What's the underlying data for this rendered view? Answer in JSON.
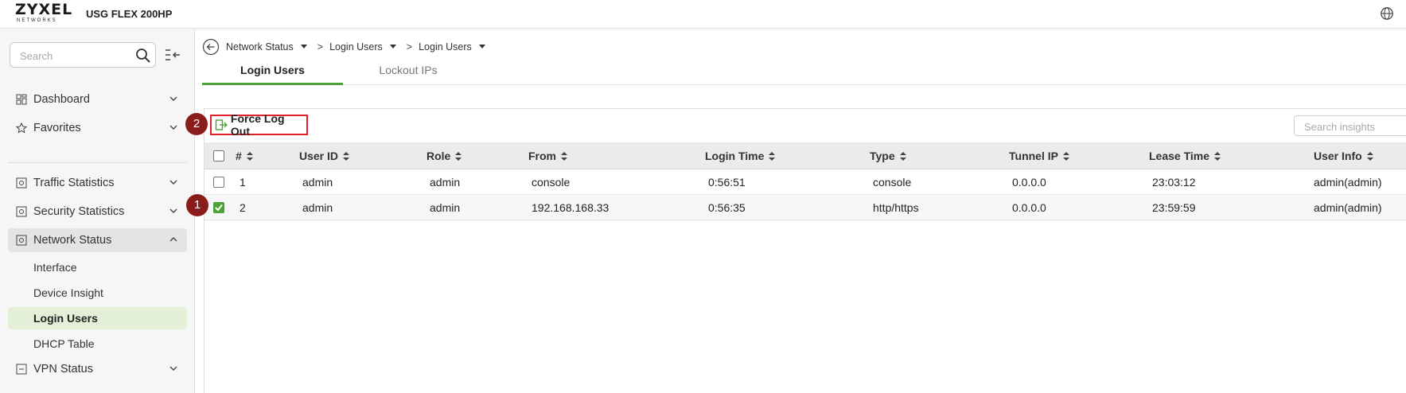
{
  "header": {
    "brand": "ZYXEL",
    "brand_sub": "NETWORKS",
    "model": "USG FLEX 200HP",
    "globe_icon": "globe-icon"
  },
  "sidebar": {
    "search_placeholder": "Search",
    "items": [
      {
        "label": "Dashboard",
        "icon": "dashboard-icon"
      },
      {
        "label": "Favorites",
        "icon": "star-icon"
      },
      {
        "label": "Traffic Statistics",
        "icon": "traffic-icon"
      },
      {
        "label": "Security Statistics",
        "icon": "security-icon"
      },
      {
        "label": "Network Status",
        "icon": "network-status-icon"
      },
      {
        "label": "VPN Status",
        "icon": "vpn-icon"
      }
    ],
    "sub_items": [
      {
        "label": "Interface"
      },
      {
        "label": "Device Insight"
      },
      {
        "label": "Login Users"
      },
      {
        "label": "DHCP Table"
      }
    ],
    "selected": "Login Users"
  },
  "breadcrumb": {
    "items": [
      "Network Status",
      "Login Users",
      "Login Users"
    ],
    "separator": ">"
  },
  "tabs": [
    {
      "label": "Login Users",
      "active": true
    },
    {
      "label": "Lockout IPs",
      "active": false
    }
  ],
  "toolbar": {
    "force_logout_label": "Force Log Out",
    "insights_placeholder": "Search insights"
  },
  "steps": {
    "one": "1",
    "two": "2"
  },
  "table": {
    "columns": [
      "#",
      "User ID",
      "Role",
      "From",
      "Login Time",
      "Type",
      "Tunnel IP",
      "Lease Time",
      "User Info"
    ],
    "rows": [
      {
        "checked": false,
        "num": "1",
        "user_id": "admin",
        "role": "admin",
        "from": "console",
        "login_time": "0:56:51",
        "type": "console",
        "tunnel_ip": "0.0.0.0",
        "lease_time": "23:03:12",
        "user_info": "admin(admin)"
      },
      {
        "checked": true,
        "num": "2",
        "user_id": "admin",
        "role": "admin",
        "from": "192.168.168.33",
        "login_time": "0:56:35",
        "type": "http/https",
        "tunnel_ip": "0.0.0.0",
        "lease_time": "23:59:59",
        "user_info": "admin(admin)"
      }
    ]
  },
  "colors": {
    "accent": "#4aa339",
    "highlight_border": "#e0202a",
    "badge": "#8b1c1c",
    "selected_bg": "#e3efd6"
  }
}
